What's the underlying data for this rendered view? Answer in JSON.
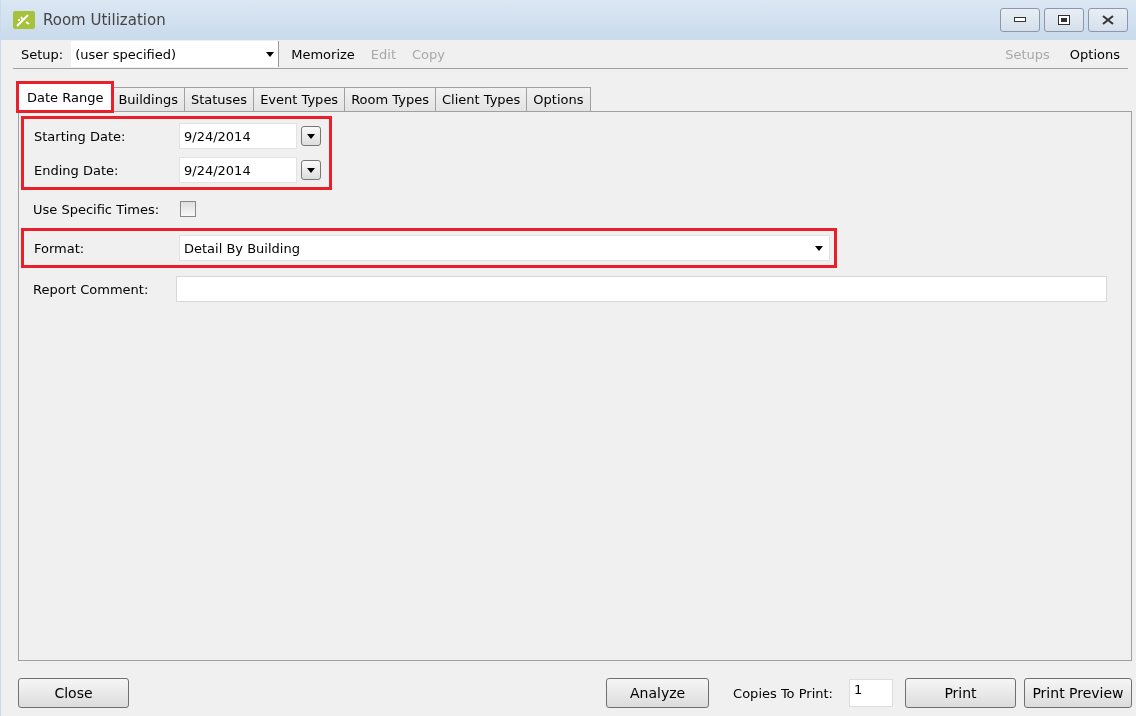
{
  "window": {
    "title": "Room Utilization"
  },
  "toolbar": {
    "setup_label": "Setup:",
    "setup_value": "(user specified)",
    "actions": [
      {
        "label": "Memorize",
        "disabled": false
      },
      {
        "label": "Edit",
        "disabled": true
      },
      {
        "label": "Copy",
        "disabled": true
      }
    ],
    "right_actions": [
      {
        "label": "Setups",
        "disabled": true
      },
      {
        "label": "Options",
        "disabled": false
      }
    ]
  },
  "tabs": [
    {
      "label": "Date Range",
      "selected": true,
      "highlighted": true
    },
    {
      "label": "Buildings",
      "selected": false,
      "highlighted": false
    },
    {
      "label": "Statuses",
      "selected": false,
      "highlighted": false
    },
    {
      "label": "Event Types",
      "selected": false,
      "highlighted": false
    },
    {
      "label": "Room Types",
      "selected": false,
      "highlighted": false
    },
    {
      "label": "Client Types",
      "selected": false,
      "highlighted": false
    },
    {
      "label": "Options",
      "selected": false,
      "highlighted": false
    }
  ],
  "sections": [
    {
      "highlighted": true,
      "rows": [
        {
          "kind": "date",
          "label": "Starting Date:",
          "value": "9/24/2014"
        },
        {
          "kind": "date",
          "label": "Ending Date:",
          "value": "9/24/2014"
        }
      ]
    },
    {
      "highlighted": false,
      "rows": [
        {
          "kind": "checkbox",
          "label": "Use Specific Times:",
          "checked": false
        }
      ]
    },
    {
      "highlighted": true,
      "rows": [
        {
          "kind": "select",
          "label": "Format:",
          "value": "Detail By Building"
        }
      ]
    },
    {
      "highlighted": false,
      "rows": [
        {
          "kind": "text",
          "label": "Report Comment:"
        }
      ]
    }
  ],
  "footer": {
    "close": "Close",
    "analyze": "Analyze",
    "copies_label": "Copies To Print:",
    "copies_value": "1",
    "print": "Print",
    "print_preview": "Print Preview"
  }
}
